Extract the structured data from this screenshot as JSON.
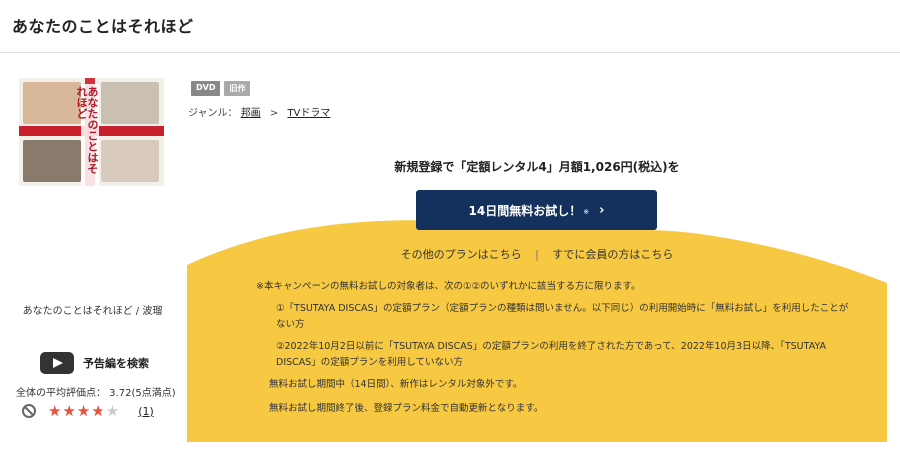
{
  "page": {
    "title": "あなたのことはそれほど"
  },
  "thumbnail": {
    "title_text": "あなたのことはそれほど"
  },
  "sidebar": {
    "series_caption": "あなたのことはそれほど / 波瑠",
    "trailer_label": "予告編を検索",
    "rating_label": "全体の平均評価点： 3.72(5点満点)",
    "rating_value": 3.72,
    "rating_max": 5,
    "stars": "★★★★★",
    "review_count": "(1)"
  },
  "badges": {
    "dvd": "DVD",
    "old": "旧作"
  },
  "genre": {
    "label": "ジャンル：",
    "item1": "邦画",
    "sep": ">",
    "item2": "TVドラマ"
  },
  "campaign": {
    "headline": "新規登録で「定額レンタル4」月額1,026円(税込)を",
    "cta_label": "14日間無料お試し！",
    "cta_mark": "※",
    "cta_arrow": "›",
    "link_other": "その他のプランはこちら",
    "link_divider": "|",
    "link_member": "すでに会員の方はこちら",
    "notes": {
      "intro": "※本キャンペーンの無料お試しの対象者は、次の①②のいずれかに該当する方に限ります。",
      "item1": "①「TSUTAYA DISCAS」の定額プラン（定額プランの種類は問いません。以下同じ）の利用開始時に「無料お試し」を利用したことがない方",
      "item2": "②2022年10月2日以前に「TSUTAYA DISCAS」の定額プランの利用を終了された方であって、2022年10月3日以降、「TSUTAYA DISCAS」の定額プランを利用していない方",
      "line1": "無料お試し期間中（14日間）、新作はレンタル対象外です。",
      "line2": "無料お試し期間終了後、登録プラン料金で自動更新となります。"
    }
  },
  "colors": {
    "accent_yellow": "#f7c842",
    "cta_navy": "#14305c",
    "star_red": "#e8533e",
    "ribbon_red": "#c8202c"
  }
}
